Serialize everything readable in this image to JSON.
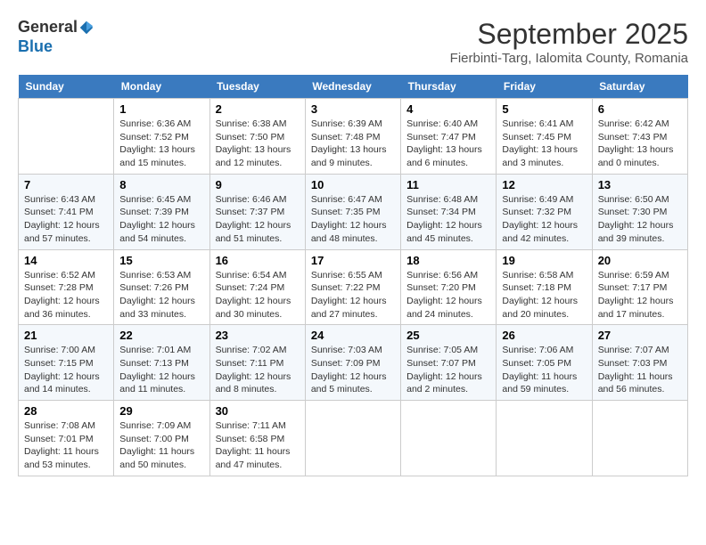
{
  "header": {
    "logo_general": "General",
    "logo_blue": "Blue",
    "month_title": "September 2025",
    "subtitle": "Fierbinti-Targ, Ialomita County, Romania"
  },
  "days_of_week": [
    "Sunday",
    "Monday",
    "Tuesday",
    "Wednesday",
    "Thursday",
    "Friday",
    "Saturday"
  ],
  "weeks": [
    [
      {
        "day": "",
        "sunrise": "",
        "sunset": "",
        "daylight": ""
      },
      {
        "day": "1",
        "sunrise": "Sunrise: 6:36 AM",
        "sunset": "Sunset: 7:52 PM",
        "daylight": "Daylight: 13 hours and 15 minutes."
      },
      {
        "day": "2",
        "sunrise": "Sunrise: 6:38 AM",
        "sunset": "Sunset: 7:50 PM",
        "daylight": "Daylight: 13 hours and 12 minutes."
      },
      {
        "day": "3",
        "sunrise": "Sunrise: 6:39 AM",
        "sunset": "Sunset: 7:48 PM",
        "daylight": "Daylight: 13 hours and 9 minutes."
      },
      {
        "day": "4",
        "sunrise": "Sunrise: 6:40 AM",
        "sunset": "Sunset: 7:47 PM",
        "daylight": "Daylight: 13 hours and 6 minutes."
      },
      {
        "day": "5",
        "sunrise": "Sunrise: 6:41 AM",
        "sunset": "Sunset: 7:45 PM",
        "daylight": "Daylight: 13 hours and 3 minutes."
      },
      {
        "day": "6",
        "sunrise": "Sunrise: 6:42 AM",
        "sunset": "Sunset: 7:43 PM",
        "daylight": "Daylight: 13 hours and 0 minutes."
      }
    ],
    [
      {
        "day": "7",
        "sunrise": "Sunrise: 6:43 AM",
        "sunset": "Sunset: 7:41 PM",
        "daylight": "Daylight: 12 hours and 57 minutes."
      },
      {
        "day": "8",
        "sunrise": "Sunrise: 6:45 AM",
        "sunset": "Sunset: 7:39 PM",
        "daylight": "Daylight: 12 hours and 54 minutes."
      },
      {
        "day": "9",
        "sunrise": "Sunrise: 6:46 AM",
        "sunset": "Sunset: 7:37 PM",
        "daylight": "Daylight: 12 hours and 51 minutes."
      },
      {
        "day": "10",
        "sunrise": "Sunrise: 6:47 AM",
        "sunset": "Sunset: 7:35 PM",
        "daylight": "Daylight: 12 hours and 48 minutes."
      },
      {
        "day": "11",
        "sunrise": "Sunrise: 6:48 AM",
        "sunset": "Sunset: 7:34 PM",
        "daylight": "Daylight: 12 hours and 45 minutes."
      },
      {
        "day": "12",
        "sunrise": "Sunrise: 6:49 AM",
        "sunset": "Sunset: 7:32 PM",
        "daylight": "Daylight: 12 hours and 42 minutes."
      },
      {
        "day": "13",
        "sunrise": "Sunrise: 6:50 AM",
        "sunset": "Sunset: 7:30 PM",
        "daylight": "Daylight: 12 hours and 39 minutes."
      }
    ],
    [
      {
        "day": "14",
        "sunrise": "Sunrise: 6:52 AM",
        "sunset": "Sunset: 7:28 PM",
        "daylight": "Daylight: 12 hours and 36 minutes."
      },
      {
        "day": "15",
        "sunrise": "Sunrise: 6:53 AM",
        "sunset": "Sunset: 7:26 PM",
        "daylight": "Daylight: 12 hours and 33 minutes."
      },
      {
        "day": "16",
        "sunrise": "Sunrise: 6:54 AM",
        "sunset": "Sunset: 7:24 PM",
        "daylight": "Daylight: 12 hours and 30 minutes."
      },
      {
        "day": "17",
        "sunrise": "Sunrise: 6:55 AM",
        "sunset": "Sunset: 7:22 PM",
        "daylight": "Daylight: 12 hours and 27 minutes."
      },
      {
        "day": "18",
        "sunrise": "Sunrise: 6:56 AM",
        "sunset": "Sunset: 7:20 PM",
        "daylight": "Daylight: 12 hours and 24 minutes."
      },
      {
        "day": "19",
        "sunrise": "Sunrise: 6:58 AM",
        "sunset": "Sunset: 7:18 PM",
        "daylight": "Daylight: 12 hours and 20 minutes."
      },
      {
        "day": "20",
        "sunrise": "Sunrise: 6:59 AM",
        "sunset": "Sunset: 7:17 PM",
        "daylight": "Daylight: 12 hours and 17 minutes."
      }
    ],
    [
      {
        "day": "21",
        "sunrise": "Sunrise: 7:00 AM",
        "sunset": "Sunset: 7:15 PM",
        "daylight": "Daylight: 12 hours and 14 minutes."
      },
      {
        "day": "22",
        "sunrise": "Sunrise: 7:01 AM",
        "sunset": "Sunset: 7:13 PM",
        "daylight": "Daylight: 12 hours and 11 minutes."
      },
      {
        "day": "23",
        "sunrise": "Sunrise: 7:02 AM",
        "sunset": "Sunset: 7:11 PM",
        "daylight": "Daylight: 12 hours and 8 minutes."
      },
      {
        "day": "24",
        "sunrise": "Sunrise: 7:03 AM",
        "sunset": "Sunset: 7:09 PM",
        "daylight": "Daylight: 12 hours and 5 minutes."
      },
      {
        "day": "25",
        "sunrise": "Sunrise: 7:05 AM",
        "sunset": "Sunset: 7:07 PM",
        "daylight": "Daylight: 12 hours and 2 minutes."
      },
      {
        "day": "26",
        "sunrise": "Sunrise: 7:06 AM",
        "sunset": "Sunset: 7:05 PM",
        "daylight": "Daylight: 11 hours and 59 minutes."
      },
      {
        "day": "27",
        "sunrise": "Sunrise: 7:07 AM",
        "sunset": "Sunset: 7:03 PM",
        "daylight": "Daylight: 11 hours and 56 minutes."
      }
    ],
    [
      {
        "day": "28",
        "sunrise": "Sunrise: 7:08 AM",
        "sunset": "Sunset: 7:01 PM",
        "daylight": "Daylight: 11 hours and 53 minutes."
      },
      {
        "day": "29",
        "sunrise": "Sunrise: 7:09 AM",
        "sunset": "Sunset: 7:00 PM",
        "daylight": "Daylight: 11 hours and 50 minutes."
      },
      {
        "day": "30",
        "sunrise": "Sunrise: 7:11 AM",
        "sunset": "Sunset: 6:58 PM",
        "daylight": "Daylight: 11 hours and 47 minutes."
      },
      {
        "day": "",
        "sunrise": "",
        "sunset": "",
        "daylight": ""
      },
      {
        "day": "",
        "sunrise": "",
        "sunset": "",
        "daylight": ""
      },
      {
        "day": "",
        "sunrise": "",
        "sunset": "",
        "daylight": ""
      },
      {
        "day": "",
        "sunrise": "",
        "sunset": "",
        "daylight": ""
      }
    ]
  ]
}
